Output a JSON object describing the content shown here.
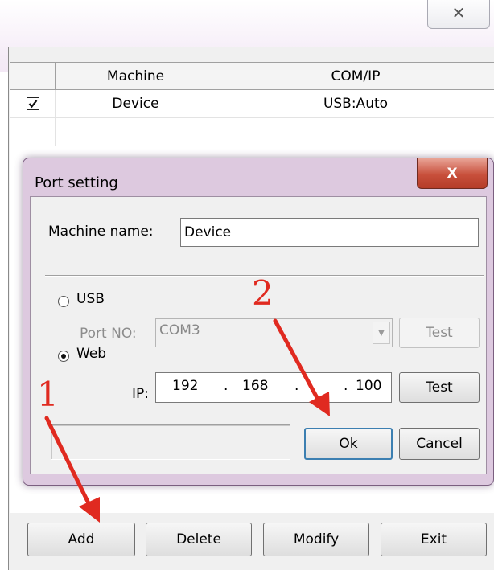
{
  "window": {
    "close_glyph": "✕"
  },
  "grid": {
    "columns": [
      "",
      "Machine",
      "COM/IP"
    ],
    "rows": [
      {
        "checked": true,
        "machine": "Device",
        "com_ip": "USB:Auto"
      }
    ]
  },
  "footer": {
    "add_label": "Add",
    "delete_label": "Delete",
    "modify_label": "Modify",
    "exit_label": "Exit"
  },
  "dialog": {
    "title": "Port setting",
    "close_glyph": "X",
    "machine_name_label": "Machine name:",
    "machine_name_value": "Device",
    "usb_label": "USB",
    "usb_selected": false,
    "port_no_label": "Port NO:",
    "port_no_value": "COM3",
    "usb_test_label": "Test",
    "web_label": "Web",
    "web_selected": true,
    "ip_label": "IP:",
    "ip_octets": [
      "192",
      "168",
      "",
      "100"
    ],
    "web_test_label": "Test",
    "ok_label": "Ok",
    "cancel_label": "Cancel"
  },
  "annotations": {
    "step1": "1",
    "step2": "2",
    "color": "#e02a20"
  },
  "colors": {
    "dialog_frame": "#ddc9df",
    "dialog_close": "#c8503c",
    "panel_bg": "#f0f0f0"
  }
}
